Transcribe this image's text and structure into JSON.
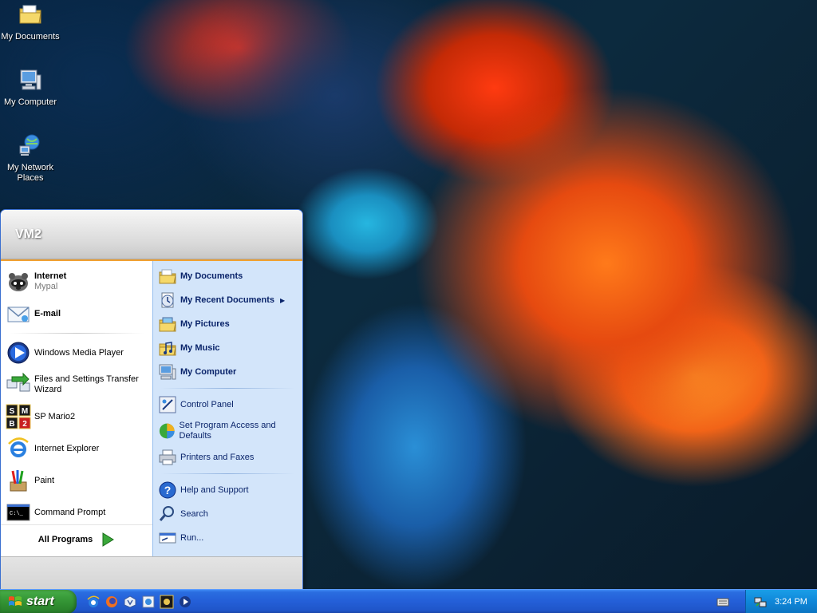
{
  "desktop": {
    "icons": [
      {
        "label": "My Documents",
        "icon": "folder-icon"
      },
      {
        "label": "My Computer",
        "icon": "computer-icon"
      },
      {
        "label": "My Network Places",
        "icon": "network-icon"
      }
    ]
  },
  "start_menu": {
    "user": "VM2",
    "pinned": [
      {
        "label": "Internet",
        "sublabel": "Mypal",
        "icon": "browser-icon"
      },
      {
        "label": "E-mail",
        "icon": "email-icon"
      }
    ],
    "recent": [
      {
        "label": "Windows Media Player",
        "icon": "media-player-icon"
      },
      {
        "label": "Files and Settings Transfer Wizard",
        "icon": "transfer-wizard-icon"
      },
      {
        "label": "SP Mario2",
        "icon": "mario-icon"
      },
      {
        "label": "Internet Explorer",
        "icon": "ie-icon"
      },
      {
        "label": "Paint",
        "icon": "paint-icon"
      },
      {
        "label": "Command Prompt",
        "icon": "cmd-icon"
      }
    ],
    "all_programs": "All Programs",
    "places": [
      {
        "label": "My Documents",
        "icon": "folder-icon"
      },
      {
        "label": "My Recent Documents",
        "icon": "recent-docs-icon"
      },
      {
        "label": "My Pictures",
        "icon": "pictures-icon"
      },
      {
        "label": "My Music",
        "icon": "music-icon"
      },
      {
        "label": "My Computer",
        "icon": "computer-icon"
      }
    ],
    "system": [
      {
        "label": "Control Panel",
        "icon": "control-panel-icon"
      },
      {
        "label": "Set Program Access and Defaults",
        "icon": "defaults-icon"
      },
      {
        "label": "Printers and Faxes",
        "icon": "printer-icon"
      }
    ],
    "help": [
      {
        "label": "Help and Support",
        "icon": "help-icon"
      },
      {
        "label": "Search",
        "icon": "search-icon"
      },
      {
        "label": "Run...",
        "icon": "run-icon"
      }
    ]
  },
  "taskbar": {
    "start_label": "start",
    "quick_launch": [
      "ie-icon",
      "firefox-icon",
      "virtualbox-icon",
      "control-icon",
      "mario-icon",
      "media-player-icon"
    ],
    "clock": "3:24 PM"
  },
  "colors": {
    "taskbar_blue": "#245fd8",
    "start_green": "#3a9d3b",
    "menu_right_panel": "#d3e5fa",
    "menu_accent_orange": "#f0a030"
  }
}
